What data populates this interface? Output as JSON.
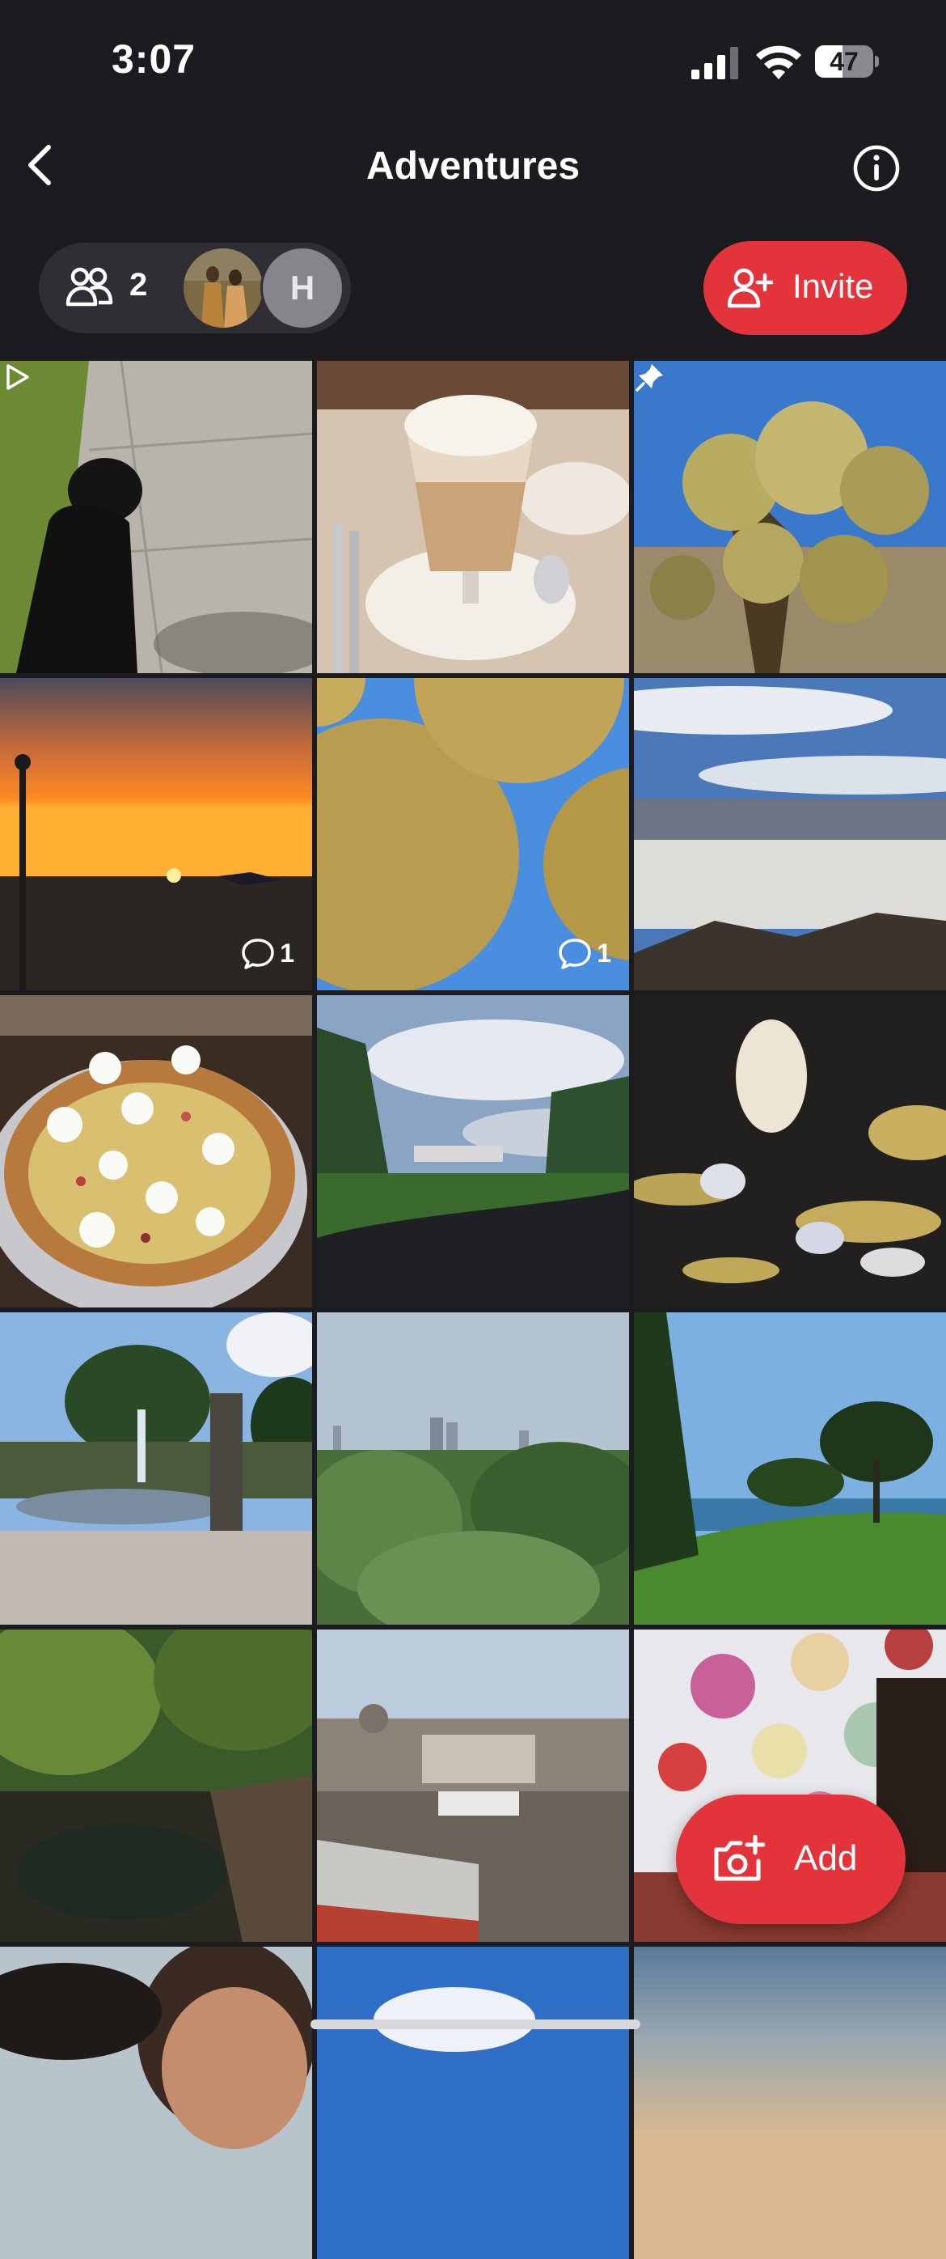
{
  "status_bar": {
    "time": "3:07",
    "battery_percent": "47",
    "battery_level": 0.47
  },
  "nav": {
    "title": "Adventures",
    "back_icon": "chevron-left-icon",
    "info_icon": "info-circle-icon"
  },
  "members": {
    "count": "2",
    "avatars": [
      {
        "type": "photo"
      },
      {
        "type": "initial",
        "initial": "H"
      }
    ]
  },
  "invite_button": {
    "label": "Invite",
    "icon": "add-person-icon"
  },
  "add_button": {
    "label": "Add",
    "icon": "camera-plus-icon"
  },
  "grid": {
    "tiles": [
      {
        "subject": "black dog on sidewalk",
        "badge": "video-play-icon"
      },
      {
        "subject": "latte macchiato glass"
      },
      {
        "subject": "cholla cactus",
        "badge": "pin-icon"
      },
      {
        "subject": "sunset over beach",
        "comments": "1"
      },
      {
        "subject": "golden dotted spheres against sky",
        "comments": "1"
      },
      {
        "subject": "valley view with clouds"
      },
      {
        "subject": "pizza with burrata"
      },
      {
        "subject": "parking lot hillside view"
      },
      {
        "subject": "hanging sculptural lights"
      },
      {
        "subject": "park fountain"
      },
      {
        "subject": "city skyline over forest"
      },
      {
        "subject": "ocean cliff park"
      },
      {
        "subject": "garden pond with bamboo"
      },
      {
        "subject": "rooftops of old city"
      },
      {
        "subject": "paper umbrellas and lanterns"
      },
      {
        "subject": "selfie"
      },
      {
        "subject": "blue sky with cloud"
      },
      {
        "subject": "evening sky"
      }
    ]
  },
  "colors": {
    "background": "#1c1c20",
    "accent": "#e3333b",
    "pill": "#2e2e34"
  }
}
